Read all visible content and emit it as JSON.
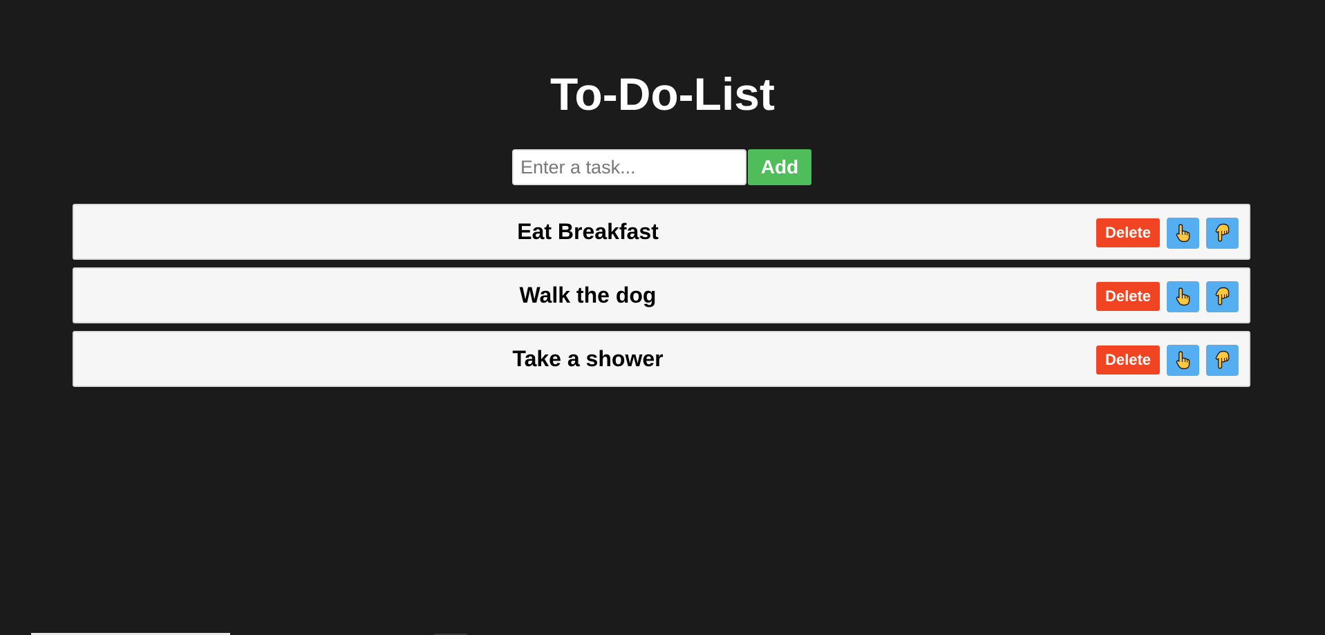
{
  "app": {
    "title": "To-Do-List"
  },
  "form": {
    "input_value": "",
    "input_placeholder": "Enter a task...",
    "add_label": "Add"
  },
  "tasks": [
    {
      "text": "Eat Breakfast",
      "delete_label": "Delete",
      "move_up_icon": "pointing-up-hand-icon",
      "move_down_icon": "pointing-down-hand-icon"
    },
    {
      "text": "Walk the dog",
      "delete_label": "Delete",
      "move_up_icon": "pointing-up-hand-icon",
      "move_down_icon": "pointing-down-hand-icon"
    },
    {
      "text": "Take a shower",
      "delete_label": "Delete",
      "move_up_icon": "pointing-up-hand-icon",
      "move_down_icon": "pointing-down-hand-icon"
    }
  ],
  "colors": {
    "background": "#1b1b1b",
    "add_button": "#4fbe5a",
    "delete_button": "#f04422",
    "move_button": "#55aef0",
    "task_background": "#f6f6f6",
    "hand_icon": "#ffc83d"
  }
}
